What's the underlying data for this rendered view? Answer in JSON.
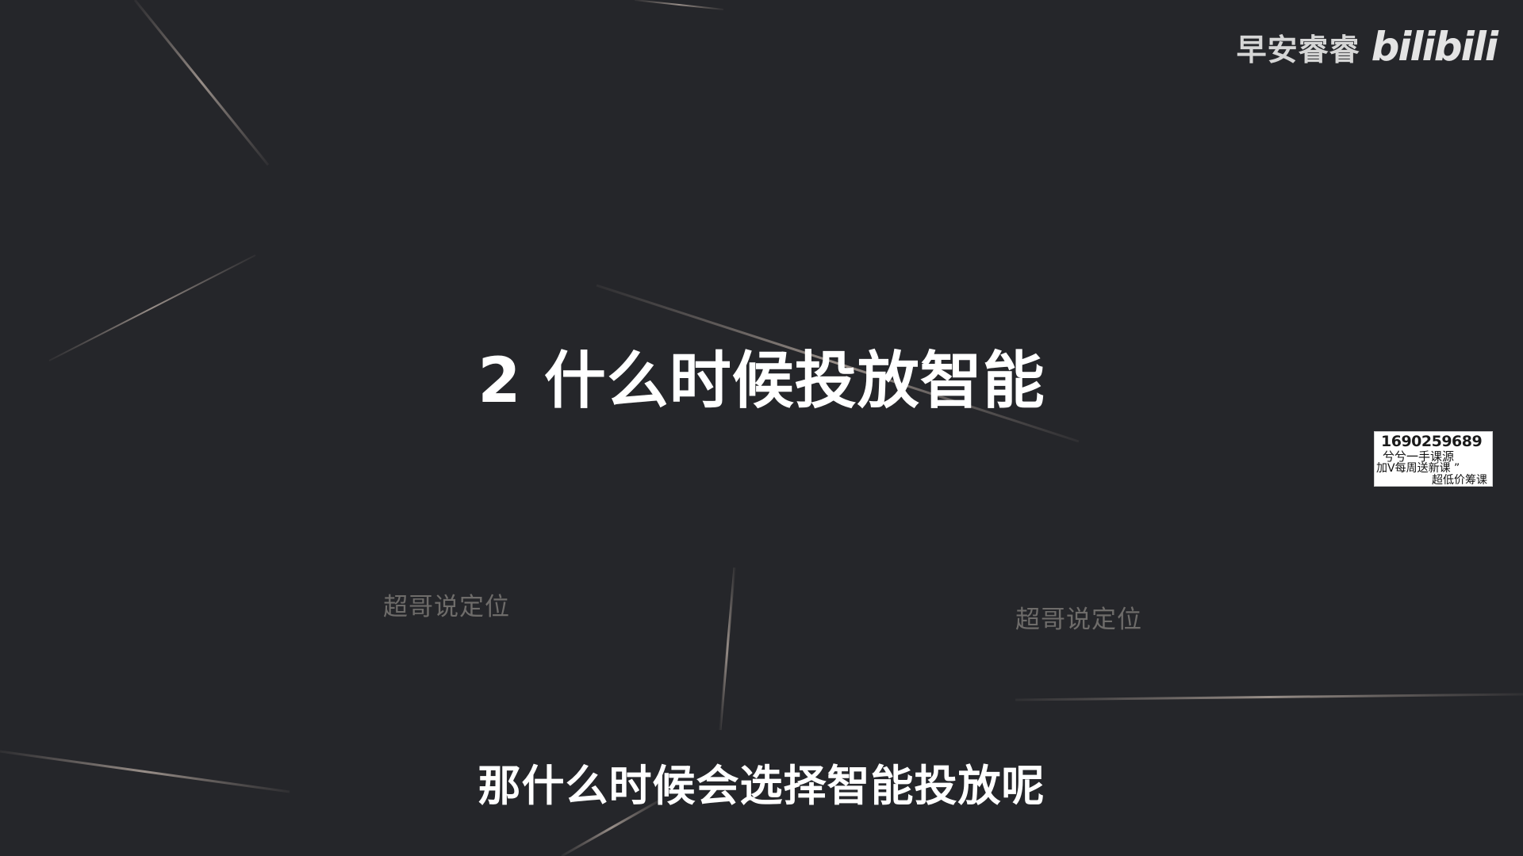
{
  "watermark": {
    "uploader": "早安睿睿",
    "platform_logo": "bilibili"
  },
  "slide": {
    "title": "2 什么时候投放智能"
  },
  "background_watermarks": [
    "超哥说定位",
    "超哥说定位"
  ],
  "ad_badge": {
    "line1": "1690259689",
    "line2": "兮兮一手课源",
    "line3": "加V每周送新课 ”",
    "line4": "超低价筹课"
  },
  "subtitle": "那什么时候会选择智能投放呢",
  "colors": {
    "background": "#25262a",
    "title": "#ffffff",
    "ghost_text": "#6e6c6a",
    "streak": "#8a807a"
  }
}
